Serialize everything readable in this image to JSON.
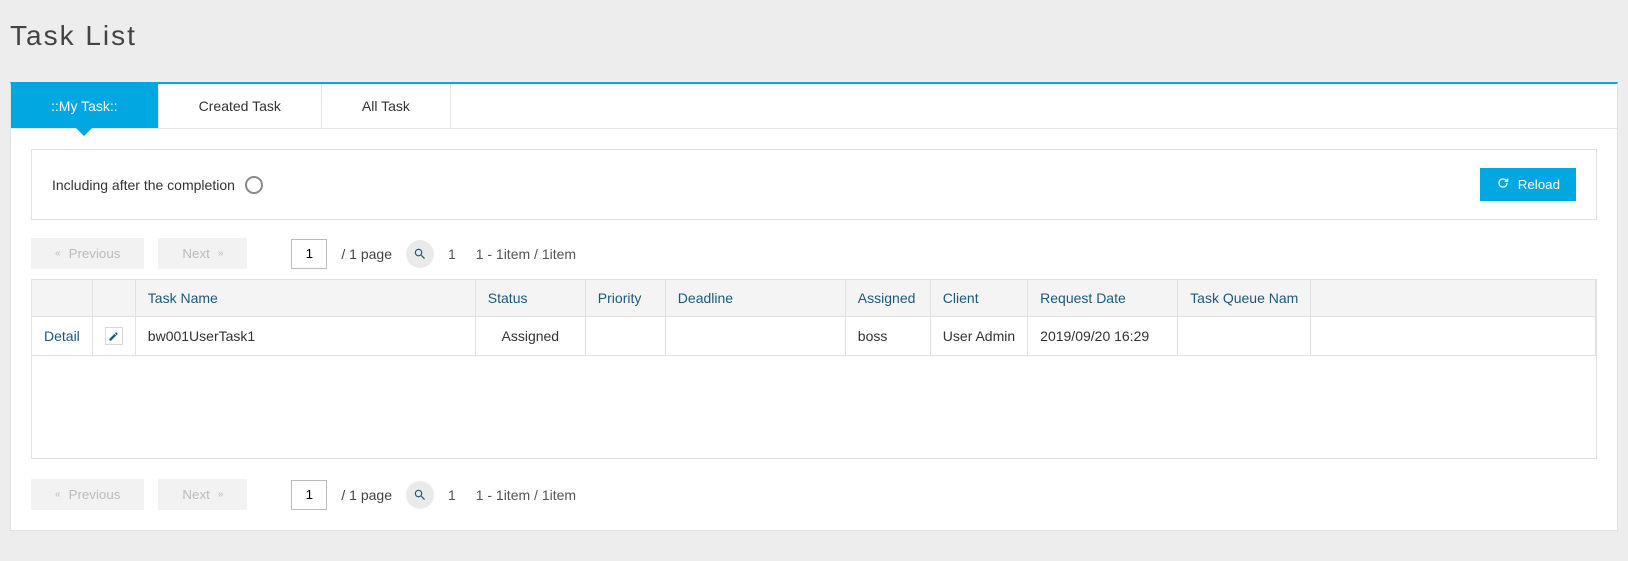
{
  "pageTitle": "Task List",
  "tabs": {
    "myTask": "::My Task::",
    "createdTask": "Created Task",
    "allTask": "All Task"
  },
  "filter": {
    "includeDoneLabel": "Including after the completion",
    "reloadLabel": "Reload"
  },
  "pager": {
    "prev": "Previous",
    "next": "Next",
    "pageInputValue": "1",
    "totalPages": "/  1 page",
    "countNumber": "1",
    "countRange": "1 - 1item / 1item"
  },
  "columns": {
    "taskName": "Task Name",
    "status": "Status",
    "priority": "Priority",
    "deadline": "Deadline",
    "assigned": "Assigned",
    "client": "Client",
    "requestDate": "Request Date",
    "taskQueueName": "Task Queue Nam"
  },
  "rows": [
    {
      "detail": "Detail",
      "taskName": "bw001UserTask1",
      "status": "Assigned",
      "priority": "",
      "deadline": "",
      "assigned": "boss",
      "client": "User Admin",
      "requestDate": "2019/09/20 16:29",
      "taskQueueName": ""
    }
  ]
}
